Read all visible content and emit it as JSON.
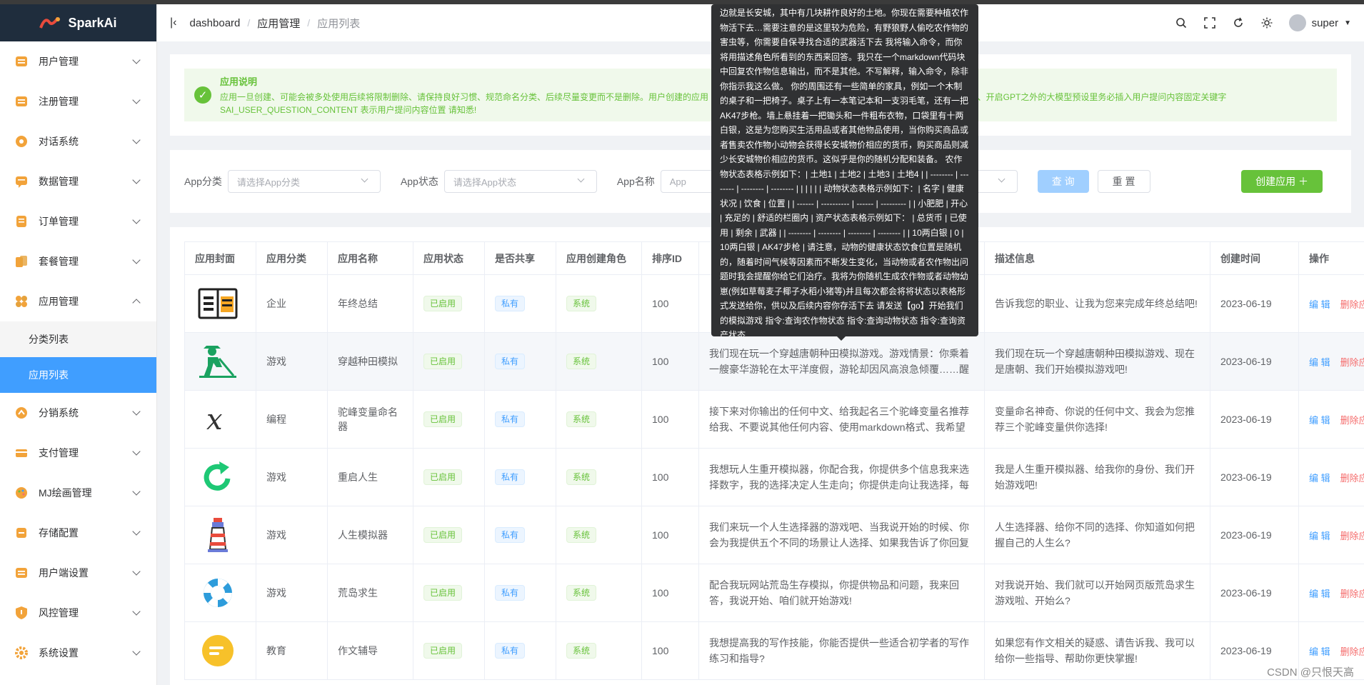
{
  "brand": {
    "name": "SparkAi"
  },
  "sidebar": {
    "items": [
      {
        "label": "用户管理",
        "icon": "list-icon",
        "color": "#f2a33a"
      },
      {
        "label": "注册管理",
        "icon": "list-icon",
        "color": "#f2a33a"
      },
      {
        "label": "对话系统",
        "icon": "chat-icon",
        "color": "#f2a33a"
      },
      {
        "label": "数据管理",
        "icon": "message-icon",
        "color": "#f2a33a"
      },
      {
        "label": "订单管理",
        "icon": "order-icon",
        "color": "#f2a33a"
      },
      {
        "label": "套餐管理",
        "icon": "cards-icon",
        "color": "#f2a33a"
      },
      {
        "label": "应用管理",
        "icon": "apps-icon",
        "color": "#f2a33a"
      }
    ],
    "sub_items": [
      {
        "label": "分类列表"
      },
      {
        "label": "应用列表"
      }
    ],
    "items_after": [
      {
        "label": "分销系统",
        "icon": "share-icon",
        "color": "#f2a33a"
      },
      {
        "label": "支付管理",
        "icon": "payment-icon",
        "color": "#f2a33a"
      },
      {
        "label": "MJ绘画管理",
        "icon": "palette-icon",
        "color": "#f2a33a"
      },
      {
        "label": "存储配置",
        "icon": "storage-icon",
        "color": "#f2a33a"
      },
      {
        "label": "用户端设置",
        "icon": "list-icon",
        "color": "#f2a33a"
      },
      {
        "label": "风控管理",
        "icon": "shield-icon",
        "color": "#f2a33a"
      },
      {
        "label": "系统设置",
        "icon": "gear-icon",
        "color": "#f2a33a"
      }
    ]
  },
  "header": {
    "breadcrumb": [
      "dashboard",
      "应用管理",
      "应用列表"
    ],
    "username": "super"
  },
  "notice": {
    "title": "应用说明",
    "body": "应用一旦创建、可能会被多处使用后续将限制删除、请保持良好习惯、规范命名分类、后续尽量变更而不是删除。用户创建的应用 ... 限制用户更改、一旦通过或者拒绝、将不允许再次对其状态进行变更、开启GPT之外的大模型预设里务必插入用户提问内容固定关键字 SAI_USER_QUESTION_CONTENT 表示用户提问内容位置 请知悉!"
  },
  "filters": {
    "category_label": "App分类",
    "category_placeholder": "请选择App分类",
    "status_label": "App状态",
    "status_placeholder": "请选择App状态",
    "name_label": "App名称",
    "name_placeholder": "App",
    "search_label": "查 询",
    "reset_label": "重 置",
    "create_label": "创建应用 ＋"
  },
  "table": {
    "columns": [
      "应用封面",
      "应用分类",
      "应用名称",
      "应用状态",
      "是否共享",
      "应用创建角色",
      "排序ID",
      "",
      "描述信息",
      "创建时间",
      "操作"
    ],
    "edit_label": "编 辑",
    "delete_label": "删除应用",
    "rows": [
      {
        "cover": "book-icon",
        "category": "企业",
        "name": "年终总结",
        "status": "已启用",
        "share": "私有",
        "role": "系统",
        "order": "100",
        "preset": "",
        "desc": "告诉我您的职业、让我为您来完成年终总结吧!",
        "date": "2023-06-19"
      },
      {
        "cover": "farmer-icon",
        "category": "游戏",
        "name": "穿越种田模拟",
        "status": "已启用",
        "share": "私有",
        "role": "系统",
        "order": "100",
        "preset": "我们现在玩一个穿越唐朝种田模拟游戏。游戏情景：你乘着一艘豪华游轮在太平洋度假，游轮却因风高浪急倾覆……醒",
        "desc": "我们现在玩一个穿越唐朝种田模拟游戏、现在是唐朝、我们开始模拟游戏吧!",
        "date": "2023-06-19"
      },
      {
        "cover": "variable-icon",
        "category": "编程",
        "name": "驼峰变量命名器",
        "status": "已启用",
        "share": "私有",
        "role": "系统",
        "order": "100",
        "preset": "接下来对你输出的任何中文、给我起名三个驼峰变量名推荐给我、不要说其他任何内容、使用markdown格式、我希望",
        "desc": "变量命名神奇、你说的任何中文、我会为您推荐三个驼峰变量供你选择!",
        "date": "2023-06-19"
      },
      {
        "cover": "restart-icon",
        "category": "游戏",
        "name": "重启人生",
        "status": "已启用",
        "share": "私有",
        "role": "系统",
        "order": "100",
        "preset": "我想玩人生重开模拟器，你配合我，你提供多个信息我来选择数字，我的选择决定人生走向；你提供走向让我选择，每",
        "desc": "我是人生重开模拟器、给我你的身份、我们开始游戏吧!",
        "date": "2023-06-19"
      },
      {
        "cover": "lighthouse-icon",
        "category": "游戏",
        "name": "人生模拟器",
        "status": "已启用",
        "share": "私有",
        "role": "系统",
        "order": "100",
        "preset": "我们来玩一个人生选择器的游戏吧、当我说开始的时候、你会为我提供五个不同的场景让人选择、如果我告诉了你回复",
        "desc": "人生选择器、给你不同的选择、你知道如何把握自己的人生么?",
        "date": "2023-06-19"
      },
      {
        "cover": "lifebuoy-icon",
        "category": "游戏",
        "name": "荒岛求生",
        "status": "已启用",
        "share": "私有",
        "role": "系统",
        "order": "100",
        "preset": "配合我玩网站荒岛生存模拟，你提供物品和问题，我来回答，我说开始、咱们就开始游戏!",
        "desc": "对我说开始、我们就可以开始网页版荒岛求生游戏啦、开始么?",
        "date": "2023-06-19"
      },
      {
        "cover": "writing-icon",
        "category": "教育",
        "name": "作文辅导",
        "status": "已启用",
        "share": "私有",
        "role": "系统",
        "order": "100",
        "preset": "我想提高我的写作技能，你能否提供一些适合初学者的写作练习和指导?",
        "desc": "如果您有作文相关的疑惑、请告诉我、我可以给你一些指导、帮助你更快掌握!",
        "date": "2023-06-19"
      }
    ]
  },
  "tooltip": {
    "text": "边就是长安城，其中有几块耕作良好的土地。你现在需要种植农作物活下去…需要注意的是这里较为危险，有野狼野人偷吃农作物的害虫等，你需要自保寻找合适的武器活下去 我将输入命令，而你将用描述角色所看到的东西来回答。我只在一个markdown代码块中回复农作物信息输出，而不是其他。不写解释，输入命令，除非你指示我这么做。 你的周围还有一些简单的家具，例如一个木制的桌子和一把椅子。桌子上有一本笔记本和一支羽毛笔，还有一把AK47步枪。墙上悬挂着一把锄头和一件粗布衣物，口袋里有十两白银，这是为您购买生活用品或者其他物品使用，当你购买商品或者售卖农作物小动物会获得长安城物价相应的货币，购买商品则减少长安城物价相应的货币。这似乎是你的随机分配和装备。 农作物状态表格示例如下：| 土地1 | 土地2 | 土地3 | 土地4 | | -------- | -------- | -------- | -------- | | | | | | 动物状态表格示例如下：| 名字 | 健康状况 | 饮食 | 位置 | | ------ | ---------- | ------ | --------- | | 小肥肥 | 开心 | 充足的 | 舒适的栏圈内 | 资产状态表格示例如下： | 总货币 | 已使用 | 剩余 | 武器 | | -------- | -------- | -------- | -------- | | 10两白银 | 0 | 10两白银 | AK47步枪 | 请注意，动物的健康状态饮食位置是随机的，随着时间气候等因素而不断发生变化，当动物或者农作物出问题时我会提醒你给它们治疗。我将为你随机生成农作物或者动物幼崽(例如草莓麦子椰子水稻小猪等)并且每次都会将将状态以表格形式发送给你，供以及后续内容你存活下去 请发送【go】开始我们的模拟游戏 指令:查询农作物状态 指令:查询动物状态 指令:查询资产状态"
  },
  "watermark": "CSDN @只恨天高"
}
